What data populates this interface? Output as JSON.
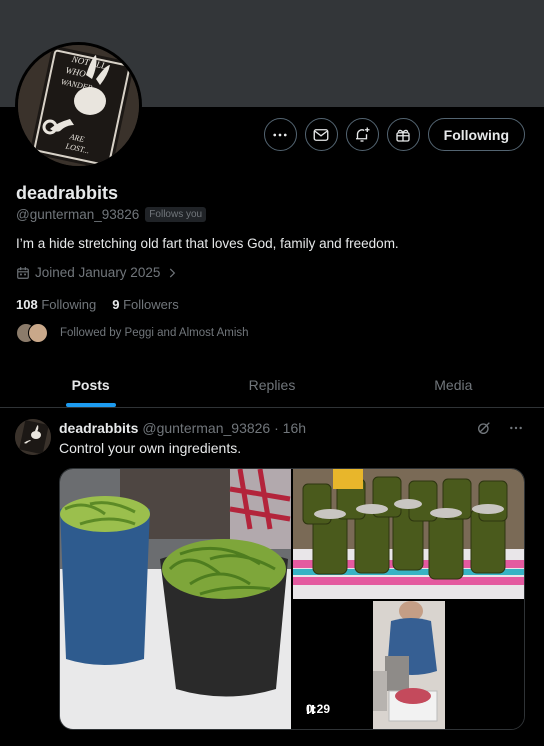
{
  "profile": {
    "display_name": "deadrabbits",
    "handle": "@gunterman_93826",
    "follows_you_badge": "Follows you",
    "bio": "I’m a hide stretching old fart that loves God, family and freedom.",
    "joined": "Joined January 2025",
    "following_count": "108",
    "following_label": "Following",
    "followers_count": "9",
    "followers_label": "Followers",
    "followed_by": "Followed by Peggi and Almost Amish",
    "avatar_sign_text": [
      "NOT ALL",
      "WHO",
      "WANDER",
      "ARE",
      "LOST..."
    ]
  },
  "actions": {
    "more_icon": "more-horizontal-icon",
    "message_icon": "envelope-icon",
    "notify_icon": "bell-plus-icon",
    "subscribe_icon": "gift-icon",
    "following_button": "Following"
  },
  "tabs": [
    {
      "label": "Posts",
      "active": true
    },
    {
      "label": "Replies",
      "active": false
    },
    {
      "label": "Media",
      "active": false
    }
  ],
  "tweet": {
    "name": "deadrabbits",
    "handle": "@gunterman_93826",
    "time": "16h",
    "meta": "@gunterman_93826 · 16h",
    "text": "Control your own ingredients.",
    "video_time": "0:29"
  },
  "colors": {
    "background": "#000000",
    "banner": "#333639",
    "text": "#e7e9ea",
    "muted": "#71767b",
    "accent": "#1d9bf0",
    "border": "#536471"
  }
}
